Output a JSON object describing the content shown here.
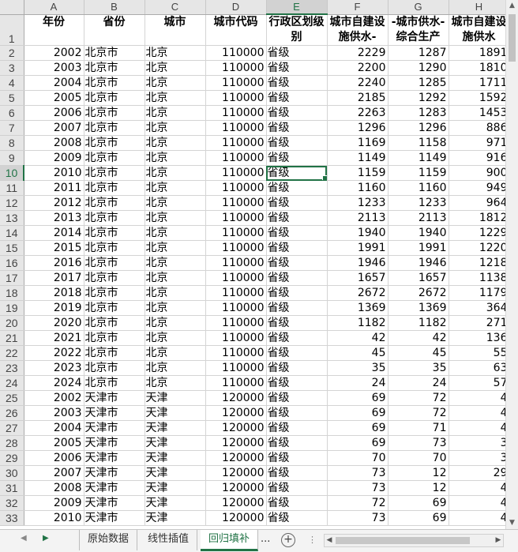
{
  "columns": [
    "A",
    "B",
    "C",
    "D",
    "E",
    "F",
    "G",
    "H"
  ],
  "header_row": {
    "num": "1",
    "cells": [
      "年份",
      "省份",
      "城市",
      "城市代码",
      "行政区划级别",
      "城市自建设施供水-",
      "-城市供水-综合生产",
      "城市自建设施供水"
    ]
  },
  "rows": [
    {
      "n": "2",
      "year": "2002",
      "prov": "北京市",
      "city": "北京",
      "code": "110000",
      "level": "省级",
      "f": "2229",
      "g": "1287",
      "h": "1891"
    },
    {
      "n": "3",
      "year": "2003",
      "prov": "北京市",
      "city": "北京",
      "code": "110000",
      "level": "省级",
      "f": "2200",
      "g": "1290",
      "h": "1810"
    },
    {
      "n": "4",
      "year": "2004",
      "prov": "北京市",
      "city": "北京",
      "code": "110000",
      "level": "省级",
      "f": "2240",
      "g": "1285",
      "h": "1711"
    },
    {
      "n": "5",
      "year": "2005",
      "prov": "北京市",
      "city": "北京",
      "code": "110000",
      "level": "省级",
      "f": "2185",
      "g": "1292",
      "h": "1592"
    },
    {
      "n": "6",
      "year": "2006",
      "prov": "北京市",
      "city": "北京",
      "code": "110000",
      "level": "省级",
      "f": "2263",
      "g": "1283",
      "h": "1453"
    },
    {
      "n": "7",
      "year": "2007",
      "prov": "北京市",
      "city": "北京",
      "code": "110000",
      "level": "省级",
      "f": "1296",
      "g": "1296",
      "h": "886"
    },
    {
      "n": "8",
      "year": "2008",
      "prov": "北京市",
      "city": "北京",
      "code": "110000",
      "level": "省级",
      "f": "1169",
      "g": "1158",
      "h": "971"
    },
    {
      "n": "9",
      "year": "2009",
      "prov": "北京市",
      "city": "北京",
      "code": "110000",
      "level": "省级",
      "f": "1149",
      "g": "1149",
      "h": "916"
    },
    {
      "n": "10",
      "year": "2010",
      "prov": "北京市",
      "city": "北京",
      "code": "110000",
      "level": "省级",
      "f": "1159",
      "g": "1159",
      "h": "900",
      "active": true
    },
    {
      "n": "11",
      "year": "2011",
      "prov": "北京市",
      "city": "北京",
      "code": "110000",
      "level": "省级",
      "f": "1160",
      "g": "1160",
      "h": "949"
    },
    {
      "n": "12",
      "year": "2012",
      "prov": "北京市",
      "city": "北京",
      "code": "110000",
      "level": "省级",
      "f": "1233",
      "g": "1233",
      "h": "964"
    },
    {
      "n": "13",
      "year": "2013",
      "prov": "北京市",
      "city": "北京",
      "code": "110000",
      "level": "省级",
      "f": "2113",
      "g": "2113",
      "h": "1812"
    },
    {
      "n": "14",
      "year": "2014",
      "prov": "北京市",
      "city": "北京",
      "code": "110000",
      "level": "省级",
      "f": "1940",
      "g": "1940",
      "h": "1229"
    },
    {
      "n": "15",
      "year": "2015",
      "prov": "北京市",
      "city": "北京",
      "code": "110000",
      "level": "省级",
      "f": "1991",
      "g": "1991",
      "h": "1220"
    },
    {
      "n": "16",
      "year": "2016",
      "prov": "北京市",
      "city": "北京",
      "code": "110000",
      "level": "省级",
      "f": "1946",
      "g": "1946",
      "h": "1218"
    },
    {
      "n": "17",
      "year": "2017",
      "prov": "北京市",
      "city": "北京",
      "code": "110000",
      "level": "省级",
      "f": "1657",
      "g": "1657",
      "h": "1138"
    },
    {
      "n": "18",
      "year": "2018",
      "prov": "北京市",
      "city": "北京",
      "code": "110000",
      "level": "省级",
      "f": "2672",
      "g": "2672",
      "h": "1179"
    },
    {
      "n": "19",
      "year": "2019",
      "prov": "北京市",
      "city": "北京",
      "code": "110000",
      "level": "省级",
      "f": "1369",
      "g": "1369",
      "h": "364"
    },
    {
      "n": "20",
      "year": "2020",
      "prov": "北京市",
      "city": "北京",
      "code": "110000",
      "level": "省级",
      "f": "1182",
      "g": "1182",
      "h": "271"
    },
    {
      "n": "21",
      "year": "2021",
      "prov": "北京市",
      "city": "北京",
      "code": "110000",
      "level": "省级",
      "f": "42",
      "g": "42",
      "h": "136"
    },
    {
      "n": "22",
      "year": "2022",
      "prov": "北京市",
      "city": "北京",
      "code": "110000",
      "level": "省级",
      "f": "45",
      "g": "45",
      "h": "55"
    },
    {
      "n": "23",
      "year": "2023",
      "prov": "北京市",
      "city": "北京",
      "code": "110000",
      "level": "省级",
      "f": "35",
      "g": "35",
      "h": "63"
    },
    {
      "n": "24",
      "year": "2024",
      "prov": "北京市",
      "city": "北京",
      "code": "110000",
      "level": "省级",
      "f": "24",
      "g": "24",
      "h": "57"
    },
    {
      "n": "25",
      "year": "2002",
      "prov": "天津市",
      "city": "天津",
      "code": "120000",
      "level": "省级",
      "f": "69",
      "g": "72",
      "h": "4"
    },
    {
      "n": "26",
      "year": "2003",
      "prov": "天津市",
      "city": "天津",
      "code": "120000",
      "level": "省级",
      "f": "69",
      "g": "72",
      "h": "4"
    },
    {
      "n": "27",
      "year": "2004",
      "prov": "天津市",
      "city": "天津",
      "code": "120000",
      "level": "省级",
      "f": "69",
      "g": "71",
      "h": "4"
    },
    {
      "n": "28",
      "year": "2005",
      "prov": "天津市",
      "city": "天津",
      "code": "120000",
      "level": "省级",
      "f": "69",
      "g": "73",
      "h": "3"
    },
    {
      "n": "29",
      "year": "2006",
      "prov": "天津市",
      "city": "天津",
      "code": "120000",
      "level": "省级",
      "f": "70",
      "g": "70",
      "h": "3"
    },
    {
      "n": "30",
      "year": "2007",
      "prov": "天津市",
      "city": "天津",
      "code": "120000",
      "level": "省级",
      "f": "73",
      "g": "12",
      "h": "29"
    },
    {
      "n": "31",
      "year": "2008",
      "prov": "天津市",
      "city": "天津",
      "code": "120000",
      "level": "省级",
      "f": "73",
      "g": "12",
      "h": "4"
    },
    {
      "n": "32",
      "year": "2009",
      "prov": "天津市",
      "city": "天津",
      "code": "120000",
      "level": "省级",
      "f": "72",
      "g": "69",
      "h": "4"
    },
    {
      "n": "33",
      "year": "2010",
      "prov": "天津市",
      "city": "天津",
      "code": "120000",
      "level": "省级",
      "f": "73",
      "g": "69",
      "h": "4"
    }
  ],
  "selected_column": "E",
  "selected_row": "10",
  "sheet_tabs": [
    "原始数据",
    "线性插值",
    "回归填补"
  ],
  "active_tab": "回归填补",
  "more_label": "...",
  "add_sheet_label": "+",
  "colors": {
    "accent": "#217346",
    "header_bg": "#e6e6e6",
    "grid_line": "#d4d4d4"
  }
}
